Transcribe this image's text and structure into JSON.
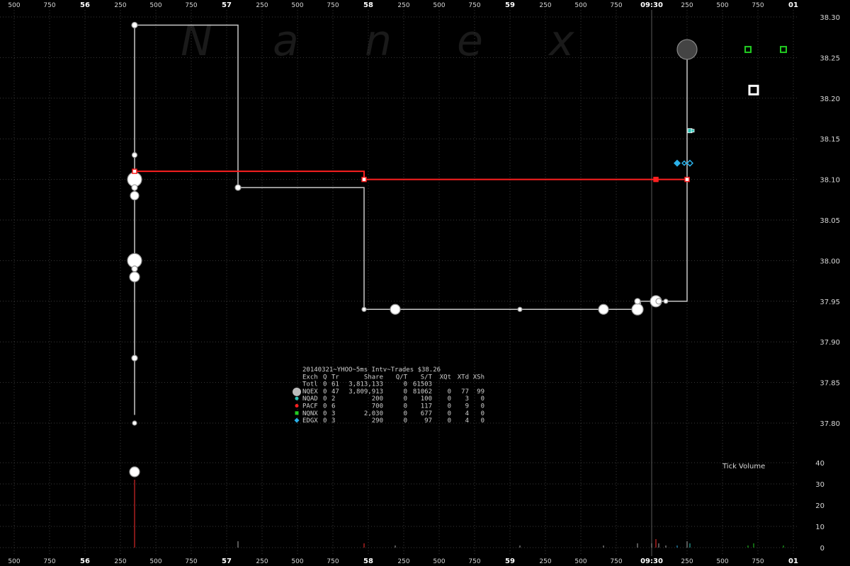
{
  "chart_data": {
    "type": "scatter",
    "watermark": [
      "N",
      "a",
      "n",
      "e",
      "x"
    ],
    "x_axis": {
      "ticks": [
        {
          "x": 0.0,
          "label": "500",
          "major": false
        },
        {
          "x": 0.25,
          "label": "750",
          "major": false
        },
        {
          "x": 0.5,
          "label": "56",
          "major": true
        },
        {
          "x": 0.75,
          "label": "250",
          "major": false
        },
        {
          "x": 1.0,
          "label": "500",
          "major": false
        },
        {
          "x": 1.25,
          "label": "750",
          "major": false
        },
        {
          "x": 1.5,
          "label": "57",
          "major": true
        },
        {
          "x": 1.75,
          "label": "250",
          "major": false
        },
        {
          "x": 2.0,
          "label": "500",
          "major": false
        },
        {
          "x": 2.25,
          "label": "750",
          "major": false
        },
        {
          "x": 2.5,
          "label": "58",
          "major": true
        },
        {
          "x": 2.75,
          "label": "250",
          "major": false
        },
        {
          "x": 3.0,
          "label": "500",
          "major": false
        },
        {
          "x": 3.25,
          "label": "750",
          "major": false
        },
        {
          "x": 3.5,
          "label": "59",
          "major": true
        },
        {
          "x": 3.75,
          "label": "250",
          "major": false
        },
        {
          "x": 4.0,
          "label": "500",
          "major": false
        },
        {
          "x": 4.25,
          "label": "750",
          "major": false
        },
        {
          "x": 4.5,
          "label": "09:30",
          "major": true
        },
        {
          "x": 4.75,
          "label": "250",
          "major": false
        },
        {
          "x": 5.0,
          "label": "500",
          "major": false
        },
        {
          "x": 5.25,
          "label": "750",
          "major": false
        },
        {
          "x": 5.5,
          "label": "01",
          "major": true
        }
      ],
      "range": [
        0.0,
        5.9
      ],
      "vertical_marker_x": 4.5
    },
    "y_axis_price": {
      "ticks": [
        "38.30",
        "38.25",
        "38.20",
        "38.15",
        "38.10",
        "38.05",
        "38.00",
        "37.95",
        "37.90",
        "37.85",
        "37.80"
      ],
      "range": [
        37.735,
        38.31
      ]
    },
    "y_axis_volume": {
      "ticks": [
        "40",
        "30",
        "20",
        "10",
        "0"
      ],
      "range": [
        0,
        40
      ],
      "label": "Tick Volume"
    },
    "colors": {
      "background": "#000000",
      "grid": "#3a3a3a",
      "nqex": "#c8c8c8",
      "nqad": "#2ec4b6",
      "pacf": "#ff2020",
      "nqnx": "#22cc22",
      "edgx": "#2ab0e8"
    },
    "series": [
      {
        "name": "NQEX",
        "color": "#c8c8c8",
        "step_line": [
          [
            0.85,
            37.81
          ],
          [
            0.85,
            38.29
          ],
          [
            1.58,
            38.29
          ],
          [
            1.58,
            38.09
          ],
          [
            2.47,
            38.09
          ],
          [
            2.47,
            37.94
          ],
          [
            4.42,
            37.94
          ],
          [
            4.42,
            37.95
          ],
          [
            4.75,
            37.95
          ],
          [
            4.75,
            38.26
          ]
        ],
        "points": [
          {
            "x": 0.85,
            "y": 38.29,
            "r": 4
          },
          {
            "x": 0.85,
            "y": 38.13,
            "r": 3.5
          },
          {
            "x": 0.85,
            "y": 38.1,
            "r": 10
          },
          {
            "x": 0.85,
            "y": 38.09,
            "r": 4
          },
          {
            "x": 0.85,
            "y": 38.08,
            "r": 6
          },
          {
            "x": 0.85,
            "y": 38.0,
            "r": 10
          },
          {
            "x": 0.85,
            "y": 37.99,
            "r": 4
          },
          {
            "x": 0.85,
            "y": 37.98,
            "r": 7
          },
          {
            "x": 0.85,
            "y": 37.88,
            "r": 4
          },
          {
            "x": 0.85,
            "y": 37.8,
            "r": 3
          },
          {
            "x": 0.85,
            "y": 37.74,
            "r": 7
          },
          {
            "x": 1.58,
            "y": 38.09,
            "r": 4
          },
          {
            "x": 2.47,
            "y": 37.94,
            "r": 3
          },
          {
            "x": 2.69,
            "y": 37.94,
            "r": 7
          },
          {
            "x": 3.57,
            "y": 37.94,
            "r": 3
          },
          {
            "x": 4.16,
            "y": 37.94,
            "r": 7
          },
          {
            "x": 4.4,
            "y": 37.94,
            "r": 8
          },
          {
            "x": 4.4,
            "y": 37.95,
            "r": 4
          },
          {
            "x": 4.53,
            "y": 37.95,
            "r": 8
          },
          {
            "x": 4.55,
            "y": 37.95,
            "r": 4
          },
          {
            "x": 4.6,
            "y": 37.95,
            "r": 3
          },
          {
            "x": 4.75,
            "y": 38.26,
            "r": 14,
            "fill": "#444444",
            "stroke": "#888888"
          }
        ]
      },
      {
        "name": "PACF",
        "color": "#ff2020",
        "step_line": [
          [
            0.85,
            38.11
          ],
          [
            2.47,
            38.11
          ],
          [
            2.47,
            38.1
          ],
          [
            4.75,
            38.1
          ]
        ],
        "points": [
          {
            "x": 0.85,
            "y": 38.11,
            "r": 3
          },
          {
            "x": 2.47,
            "y": 38.1,
            "r": 3
          },
          {
            "x": 4.53,
            "y": 38.1,
            "r": 3,
            "filled": true
          },
          {
            "x": 4.75,
            "y": 38.1,
            "r": 3
          }
        ]
      },
      {
        "name": "NQAD",
        "color": "#2ec4b6",
        "points": [
          {
            "x": 4.77,
            "y": 38.16,
            "r": 3
          },
          {
            "x": 4.79,
            "y": 38.16,
            "r": 2
          }
        ]
      },
      {
        "name": "EDGX",
        "color": "#2ab0e8",
        "points": [
          {
            "x": 4.68,
            "y": 38.12,
            "r": 4
          },
          {
            "x": 4.73,
            "y": 38.12,
            "r": 3
          },
          {
            "x": 4.77,
            "y": 38.12,
            "r": 4
          }
        ]
      },
      {
        "name": "NQNX",
        "color": "#22cc22",
        "points": [
          {
            "x": 5.18,
            "y": 38.26,
            "r": 4
          },
          {
            "x": 5.43,
            "y": 38.26,
            "r": 4
          },
          {
            "x": 5.22,
            "y": 38.21,
            "r": 6
          }
        ]
      }
    ],
    "tick_volume": [
      {
        "x": 0.85,
        "v": 32,
        "color": "#ff3030"
      },
      {
        "x": 1.58,
        "v": 3,
        "color": "#aaaaaa"
      },
      {
        "x": 2.47,
        "v": 2,
        "color": "#ff3030"
      },
      {
        "x": 2.69,
        "v": 1,
        "color": "#aaaaaa"
      },
      {
        "x": 3.57,
        "v": 1,
        "color": "#aaaaaa"
      },
      {
        "x": 4.16,
        "v": 1,
        "color": "#aaaaaa"
      },
      {
        "x": 4.4,
        "v": 2,
        "color": "#aaaaaa"
      },
      {
        "x": 4.5,
        "v": 2,
        "color": "#aaaaaa"
      },
      {
        "x": 4.53,
        "v": 4,
        "color": "#ff3030"
      },
      {
        "x": 4.55,
        "v": 2,
        "color": "#aaaaaa"
      },
      {
        "x": 4.6,
        "v": 1,
        "color": "#aaaaaa"
      },
      {
        "x": 4.68,
        "v": 1,
        "color": "#2ab0e8"
      },
      {
        "x": 4.75,
        "v": 3,
        "color": "#aaaaaa"
      },
      {
        "x": 4.77,
        "v": 2,
        "color": "#2ec4b6"
      },
      {
        "x": 5.18,
        "v": 1,
        "color": "#22cc22"
      },
      {
        "x": 5.22,
        "v": 2,
        "color": "#22cc22"
      },
      {
        "x": 5.43,
        "v": 1,
        "color": "#22cc22"
      }
    ],
    "stats": {
      "title": "20140321~YHOO~5ms Intv~Trades $38.26",
      "header": [
        "Exch",
        "Q",
        "Tr",
        "Share",
        "Q/T",
        "S/T",
        "XQt",
        "XTd",
        "XSh"
      ],
      "rows": [
        {
          "cells": [
            "Totl",
            "0",
            "61",
            "3,813,133",
            "0",
            "61503",
            "",
            "",
            ""
          ]
        },
        {
          "cells": [
            "NQEX",
            "0",
            "47",
            "3,809,913",
            "0",
            "81062",
            "0",
            "77",
            "99"
          ],
          "marker": "circle",
          "color": "#bbbbbb"
        },
        {
          "cells": [
            "NQAD",
            "0",
            "2",
            "200",
            "0",
            "100",
            "0",
            "3",
            "0"
          ],
          "marker": "dot",
          "color": "#2ec4b6"
        },
        {
          "cells": [
            "PACF",
            "0",
            "6",
            "700",
            "0",
            "117",
            "0",
            "9",
            "0"
          ],
          "marker": "dot",
          "color": "#ff2020"
        },
        {
          "cells": [
            "NQNX",
            "0",
            "3",
            "2,030",
            "0",
            "677",
            "0",
            "4",
            "0"
          ],
          "marker": "square",
          "color": "#22cc22"
        },
        {
          "cells": [
            "EDGX",
            "0",
            "3",
            "290",
            "0",
            "97",
            "0",
            "4",
            "0"
          ],
          "marker": "diamond",
          "color": "#2ab0e8"
        }
      ]
    }
  }
}
